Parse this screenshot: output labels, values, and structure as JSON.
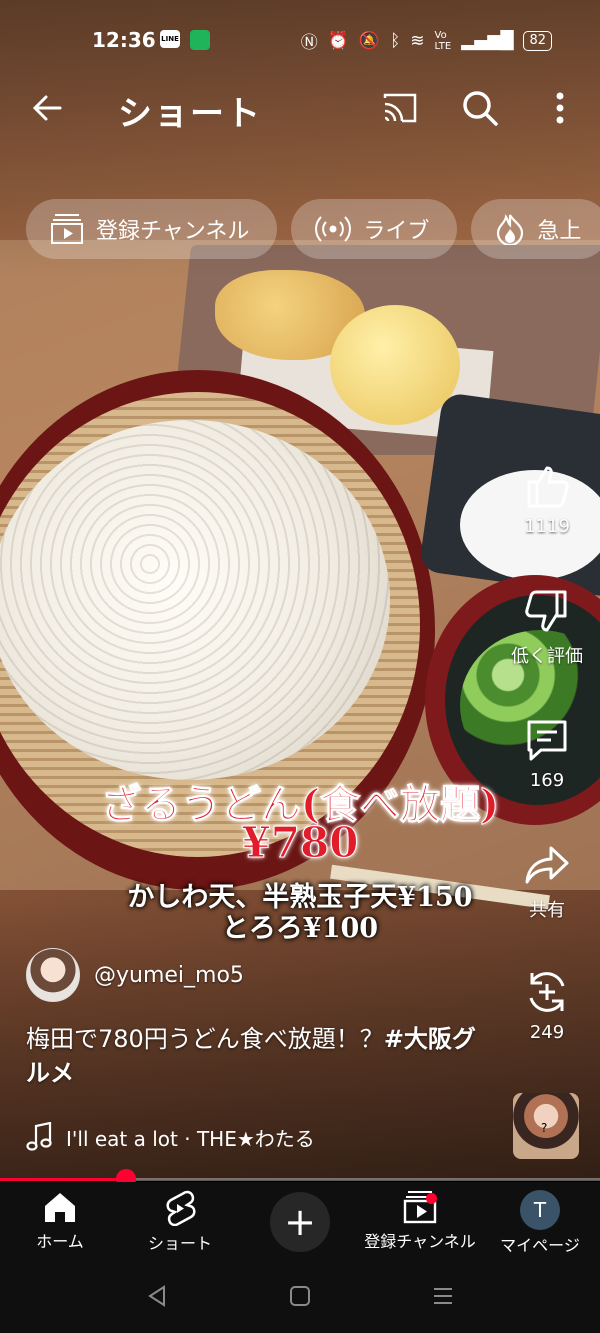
{
  "status_bar": {
    "time": "12:36",
    "line_badge": "LINE",
    "battery": "82"
  },
  "header": {
    "title": "ショート"
  },
  "chips": [
    {
      "label": "登録チャンネル",
      "icon": "subscriptions-icon"
    },
    {
      "label": "ライブ",
      "icon": "live-icon"
    },
    {
      "label": "急上",
      "icon": "trending-icon"
    }
  ],
  "video_overlay": {
    "line1": "ざるうどん(食べ放題)",
    "line2": "¥780",
    "line3": "かしわ天、半熟玉子天¥150",
    "line4": "とろろ¥100"
  },
  "actions": {
    "like_count": "1119",
    "dislike_label": "低く評価",
    "comment_count": "169",
    "share_label": "共有",
    "remix_count": "249"
  },
  "channel": {
    "handle": "@yumei_mo5"
  },
  "caption": {
    "text": "梅田で780円うどん食べ放題！？",
    "hashtag": "#大阪グルメ"
  },
  "music": {
    "track": "I'll eat a lot · THE★わたる"
  },
  "progress": {
    "fraction": 0.21,
    "color": "#ff0033"
  },
  "bottom_nav": {
    "home": "ホーム",
    "shorts": "ショート",
    "subscriptions": "登録チャンネル",
    "mypage": "マイページ",
    "avatar_letter": "T"
  }
}
